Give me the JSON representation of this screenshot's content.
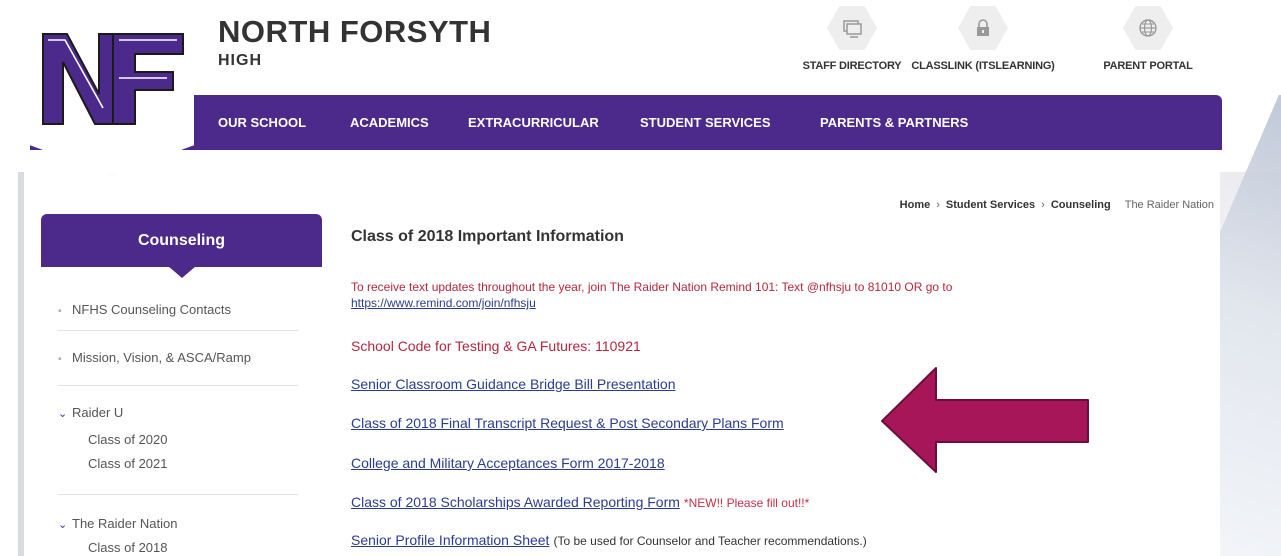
{
  "header": {
    "school_name": "NORTH FORSYTH",
    "school_sub": "HIGH",
    "quick_links": [
      {
        "label": "STAFF DIRECTORY",
        "icon": "directory-icon"
      },
      {
        "label": "CLASSLINK (ITSLEARNING)",
        "icon": "lock-icon"
      },
      {
        "label": "PARENT PORTAL",
        "icon": "globe-icon"
      }
    ]
  },
  "nav": {
    "items": [
      "OUR SCHOOL",
      "ACADEMICS",
      "EXTRACURRICULAR",
      "STUDENT SERVICES",
      "PARENTS & PARTNERS"
    ]
  },
  "breadcrumb": {
    "items": [
      "Home",
      "Student Services",
      "Counseling"
    ],
    "separator": "›",
    "current": "The Raider Nation"
  },
  "sidebar": {
    "title": "Counseling",
    "items": [
      {
        "label": "NFHS Counseling Contacts"
      },
      {
        "label": "Mission, Vision, & ASCA/Ramp"
      },
      {
        "label": "Raider U",
        "children": [
          "Class of 2020",
          "Class of 2021"
        ]
      },
      {
        "label": "The Raider Nation",
        "children": [
          "Class of 2018"
        ]
      }
    ]
  },
  "main": {
    "title": "Class of 2018 Important Information",
    "intro_text": "To receive text updates throughout the year, join The Raider Nation Remind 101: Text @nfhsju to 81010 OR go to ",
    "intro_link": "https://www.remind.com/join/nfhsju",
    "school_code": "School Code for Testing & GA Futures: 110921",
    "links": [
      {
        "label": "Senior Classroom Guidance Bridge Bill Presentation"
      },
      {
        "label": "Class of 2018 Final Transcript Request & Post Secondary Plans Form"
      },
      {
        "label": "College and Military Acceptances Form 2017-2018"
      },
      {
        "label": "Class of 2018 Scholarships Awarded Reporting Form",
        "extra": "*NEW!! Please fill out!!*"
      },
      {
        "label": "Senior Profile Information Sheet",
        "note": "(To be used for Counselor and Teacher recommendations.)"
      }
    ]
  },
  "colors": {
    "brand_purple": "#4b2a8c",
    "alert_red": "#b3283d",
    "link_blue": "#2a3c8f",
    "annotation_arrow": "#a8165a"
  }
}
